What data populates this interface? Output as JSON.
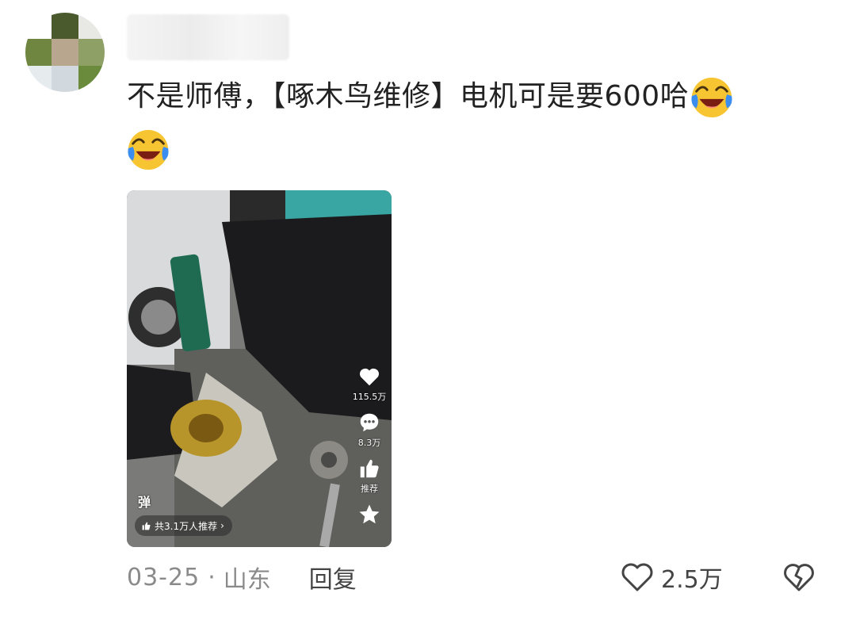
{
  "comment": {
    "text": "不是师傅，【啄木鸟维修】电机可是要600哈",
    "emoji_icon": "laughing-crying-face-icon"
  },
  "video_card": {
    "likes": "115.5万",
    "comments": "8.3万",
    "recommend_label": "推荐",
    "danmu_label": "弹",
    "recommend_pill": "共3.1万人推荐",
    "pill_arrow": "›"
  },
  "footer": {
    "date": "03-25",
    "separator": "·",
    "location": "山东",
    "reply_label": "回复",
    "like_count": "2.5万"
  },
  "colors": {
    "emoji_face": "#f7c531",
    "emoji_tear": "#3b8ef0",
    "text": "#222222",
    "meta": "#8a8a8a"
  }
}
